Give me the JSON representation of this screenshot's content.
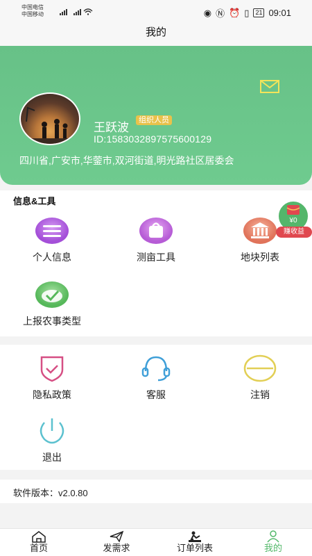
{
  "status_bar": {
    "carrier1": "中国电信",
    "carrier2": "中国移动",
    "sig1": "HD 4G",
    "sig2": "HD 5G",
    "battery": "21",
    "time": "09:01"
  },
  "header": {
    "title": "我的"
  },
  "profile": {
    "name": "王跃波",
    "role": "组织人员",
    "id_text": "ID:158303289757560012​9",
    "address": "四川省,广安市,华蓥市,双河街道,明光路社区居委会"
  },
  "tools_section": {
    "title": "信息&工具",
    "items": [
      {
        "label": "个人信息",
        "icon": "profile-card-icon"
      },
      {
        "label": "测亩工具",
        "icon": "bag-icon"
      },
      {
        "label": "地块列表",
        "icon": "building-icon"
      },
      {
        "label": "上报农事类型",
        "icon": "check-icon"
      }
    ]
  },
  "earnings": {
    "amount": "¥0",
    "button": "赚收益"
  },
  "settings_section": {
    "items": [
      {
        "label": "隐私政策",
        "icon": "shield-icon"
      },
      {
        "label": "客服",
        "icon": "headset-icon"
      },
      {
        "label": "注销",
        "icon": "minus-circle-icon"
      },
      {
        "label": "退出",
        "icon": "power-icon"
      }
    ]
  },
  "version": {
    "text": "软件版本：v2.0.80"
  },
  "tab_bar": {
    "items": [
      {
        "label": "首页",
        "icon": "home-icon"
      },
      {
        "label": "发需求",
        "icon": "send-icon"
      },
      {
        "label": "订单列表",
        "icon": "worker-icon"
      },
      {
        "label": "我的",
        "icon": "person-icon"
      }
    ]
  },
  "colors": {
    "brand_green": "#67c187",
    "badge_yellow": "#e9c24b",
    "earn_red": "#e0484f",
    "tab_active": "#53b86a"
  }
}
